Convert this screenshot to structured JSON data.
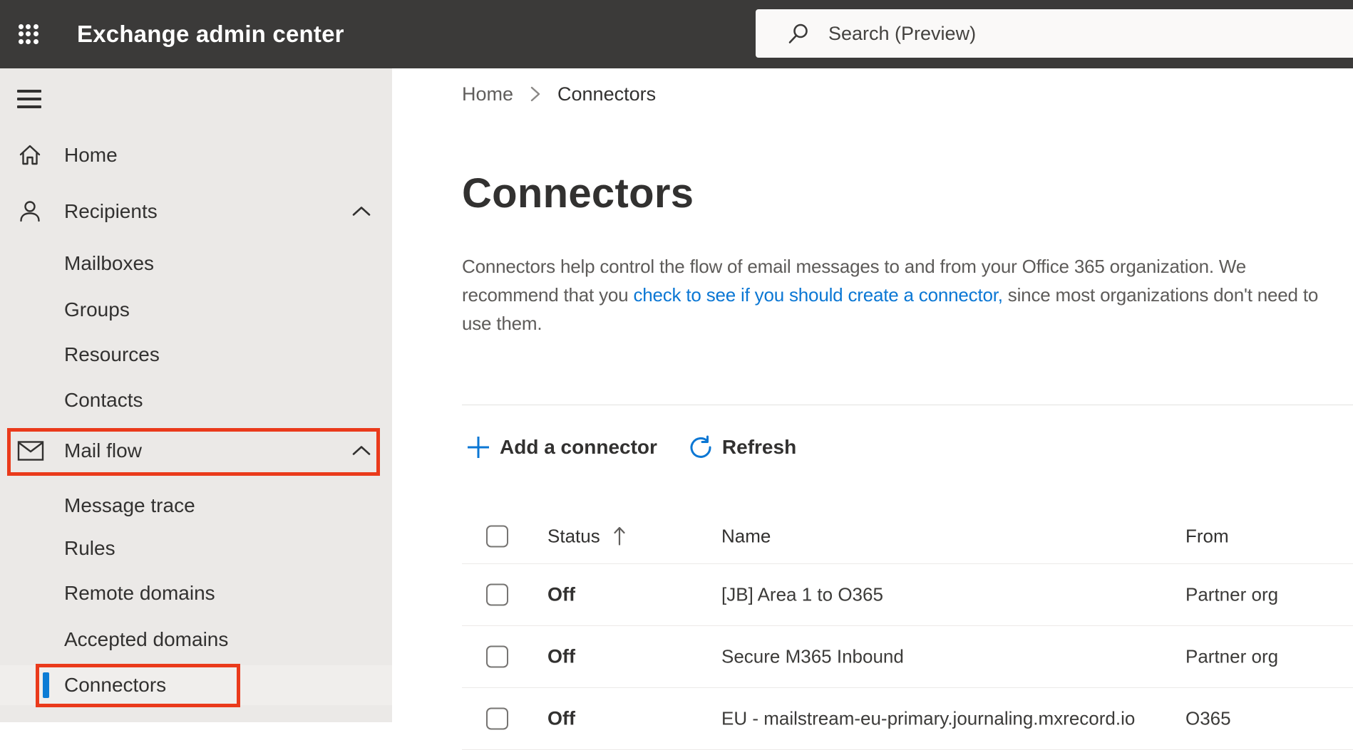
{
  "topbar": {
    "title": "Exchange admin center",
    "search_placeholder": "Search (Preview)"
  },
  "sidebar": {
    "items": [
      {
        "label": "Home",
        "icon": "home",
        "level": 0,
        "expanded": false,
        "selected": false
      },
      {
        "label": "Recipients",
        "icon": "person",
        "level": 0,
        "expanded": true,
        "selected": false
      },
      {
        "label": "Mailboxes",
        "icon": null,
        "level": 1,
        "expanded": false,
        "selected": false
      },
      {
        "label": "Groups",
        "icon": null,
        "level": 1,
        "expanded": false,
        "selected": false
      },
      {
        "label": "Resources",
        "icon": null,
        "level": 1,
        "expanded": false,
        "selected": false
      },
      {
        "label": "Contacts",
        "icon": null,
        "level": 1,
        "expanded": false,
        "selected": false
      },
      {
        "label": "Mail flow",
        "icon": "mail",
        "level": 0,
        "expanded": true,
        "selected": false,
        "annotated": true
      },
      {
        "label": "Message trace",
        "icon": null,
        "level": 1,
        "expanded": false,
        "selected": false
      },
      {
        "label": "Rules",
        "icon": null,
        "level": 1,
        "expanded": false,
        "selected": false
      },
      {
        "label": "Remote domains",
        "icon": null,
        "level": 1,
        "expanded": false,
        "selected": false
      },
      {
        "label": "Accepted domains",
        "icon": null,
        "level": 1,
        "expanded": false,
        "selected": false
      },
      {
        "label": "Connectors",
        "icon": null,
        "level": 1,
        "expanded": false,
        "selected": true,
        "annotated": true
      }
    ]
  },
  "breadcrumb": {
    "home": "Home",
    "current": "Connectors"
  },
  "page": {
    "title": "Connectors",
    "description_before_link": "Connectors help control the flow of email messages to and from your Office 365 organization. We recommend that you ",
    "description_link": "check to see if you should create a connector,",
    "description_after_link": " since most organizations don't need to use them."
  },
  "toolbar": {
    "add_label": "Add a connector",
    "refresh_label": "Refresh"
  },
  "table": {
    "columns": {
      "status": "Status",
      "name": "Name",
      "from": "From"
    },
    "sorted_by": "Status",
    "sort_direction": "ascending",
    "rows": [
      {
        "status": "Off",
        "name": "[JB] Area 1 to O365",
        "from": "Partner org"
      },
      {
        "status": "Off",
        "name": "Secure M365 Inbound",
        "from": "Partner org"
      },
      {
        "status": "Off",
        "name": "EU - mailstream-eu-primary.journaling.mxrecord.io",
        "from": "O365"
      }
    ]
  },
  "colors": {
    "topbar_bg": "#3b3a39",
    "sidebar_bg": "#ebe9e7",
    "selected_accent_blue": "#0c7cd5",
    "annotation_red": "#ea3a1b",
    "link_blue": "#0b77d4",
    "text_dark": "#323130",
    "text_secondary": "#605e5c"
  }
}
